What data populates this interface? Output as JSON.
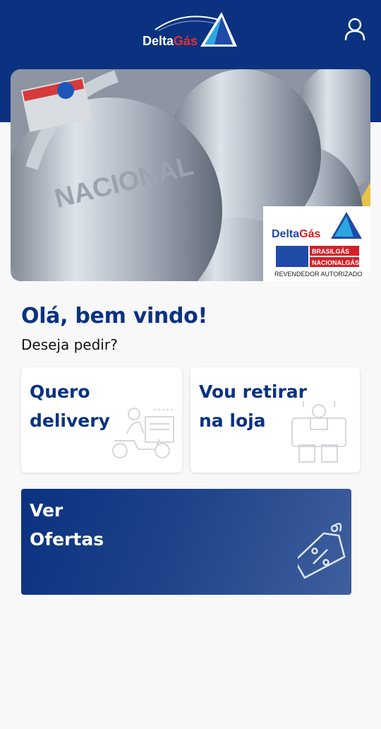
{
  "header": {
    "logo": {
      "text_delta": "Delta",
      "text_gas": "Gás",
      "brand_colors": {
        "blue": "#1f4aa8",
        "red": "#d62027",
        "light_blue": "#2aa7e0"
      }
    },
    "profile_icon": "user-icon",
    "background_color": "#0a3280"
  },
  "banner": {
    "image_subject": "gas-cylinders",
    "badge": {
      "brand_delta": "Delta",
      "brand_gas": "Gás",
      "brasilgas": "BRASILGÁS",
      "nacionalgas": "NACIONALGÁS",
      "footer": "REVENDEDOR AUTORIZADO"
    },
    "cylinder_emboss": "NACIONAL"
  },
  "main": {
    "greeting": "Olá, bem vindo!",
    "question": "Deseja pedir?",
    "cards": [
      {
        "line1": "Quero",
        "line2": "delivery",
        "icon": "delivery-scooter-icon"
      },
      {
        "line1": "Vou retirar",
        "line2": "na loja",
        "icon": "store-pickup-icon"
      }
    ],
    "offers": {
      "line1": "Ver",
      "line2": "Ofertas",
      "icon": "discount-tag-icon"
    }
  },
  "colors": {
    "primary": "#0a3280",
    "background": "#f8f8f9",
    "card": "#ffffff"
  }
}
